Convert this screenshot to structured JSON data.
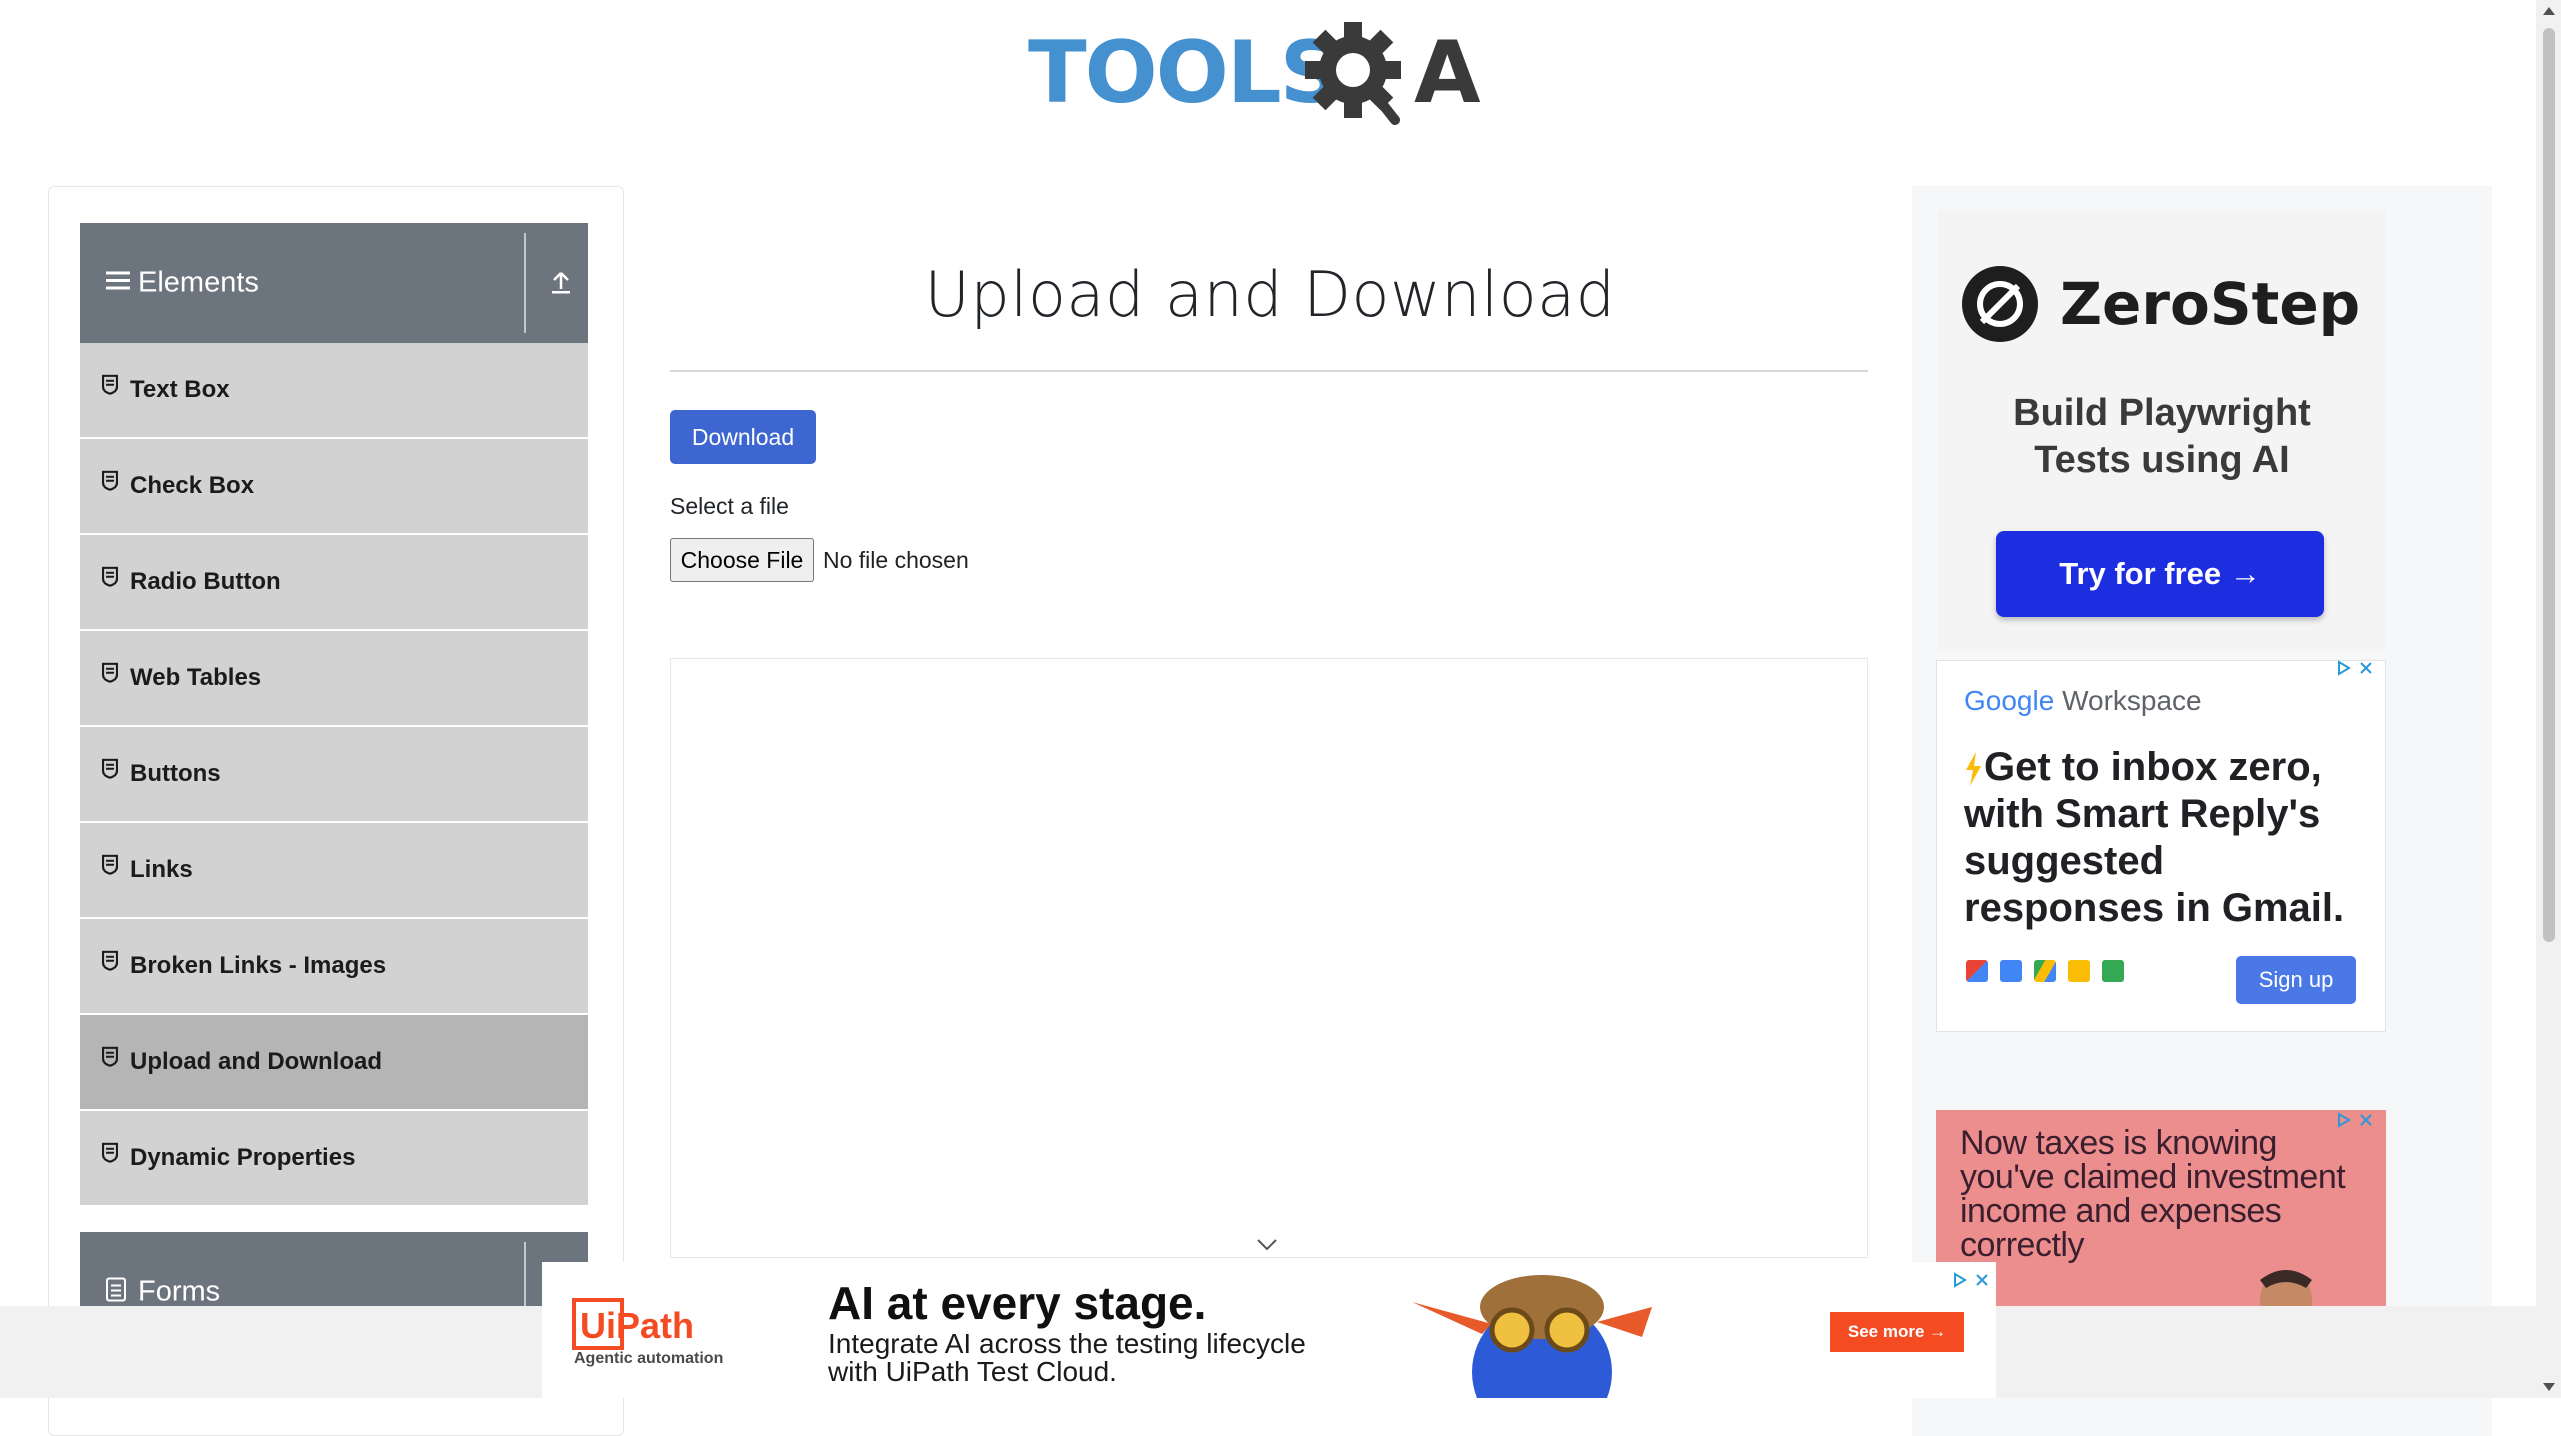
{
  "logo": {
    "text_tools": "TOOLS",
    "text_a": "A"
  },
  "sidebar": {
    "group_elements": "Elements",
    "group_forms": "Forms",
    "items": [
      {
        "label": "Text Box"
      },
      {
        "label": "Check Box"
      },
      {
        "label": "Radio Button"
      },
      {
        "label": "Web Tables"
      },
      {
        "label": "Buttons"
      },
      {
        "label": "Links"
      },
      {
        "label": "Broken Links - Images"
      },
      {
        "label": "Upload and Download",
        "active": true
      },
      {
        "label": "Dynamic Properties"
      }
    ]
  },
  "main": {
    "title": "Upload and Download",
    "download_label": "Download",
    "select_label": "Select a file",
    "choose_file_label": "Choose File",
    "file_status": "No file chosen"
  },
  "ads": {
    "zerostep": {
      "brand": "ZeroStep",
      "tagline_1": "Build Playwright",
      "tagline_2": "Tests using AI",
      "cta": "Try for free →"
    },
    "google_workspace": {
      "brand_google": "Google",
      "brand_suffix": "Workspace",
      "headline": "Get to inbox zero, with Smart Reply's suggested responses in Gmail.",
      "cta": "Sign up"
    },
    "taxes": {
      "text": "Now taxes is knowing you've claimed investment income and expenses correctly"
    },
    "uipath": {
      "logo_text": "UiPath",
      "sub": "Agentic automation",
      "headline": "AI at every stage.",
      "body": "Integrate AI across the testing lifecycle with UiPath Test Cloud.",
      "cta": "See more →"
    }
  },
  "colors": {
    "sidebar_header": "#6c757d",
    "menu_item": "#d2d2d2",
    "menu_active": "#b5b5b5",
    "primary_button": "#3e66d1",
    "zerostep_cta": "#1d2de0",
    "uipath_cta": "#f54b23"
  }
}
